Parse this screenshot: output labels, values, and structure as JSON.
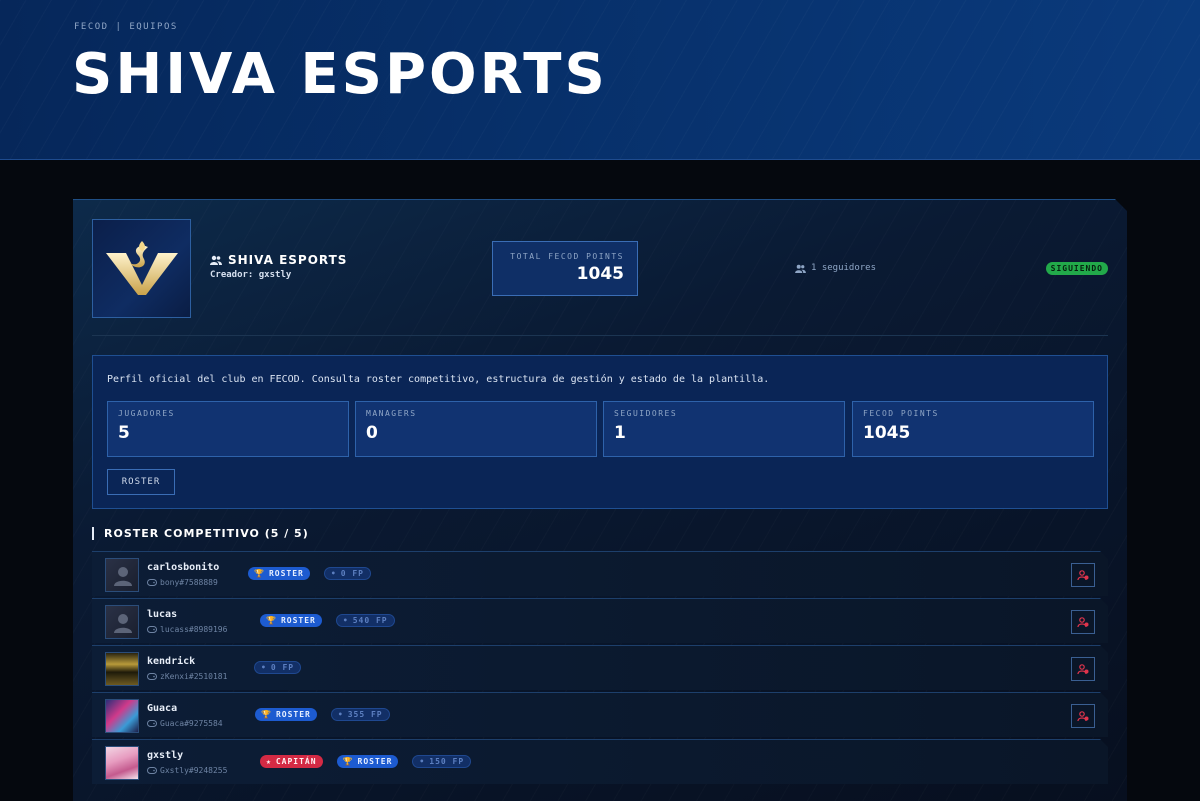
{
  "header": {
    "breadcrumb": "FECOD | EQUIPOS",
    "title": "SHIVA ESPORTS"
  },
  "team": {
    "name": "SHIVA ESPORTS",
    "creator": "Creador: gxstly",
    "points_label": "TOTAL FECOD POINTS",
    "points_value": "1045",
    "followers": "1 seguidores",
    "follow_status": "SIGUIENDO"
  },
  "info": {
    "description": "Perfil oficial del club en FECOD. Consulta roster competitivo, estructura de gestión y estado de la plantilla.",
    "stats": [
      {
        "label": "JUGADORES",
        "value": "5"
      },
      {
        "label": "MANAGERS",
        "value": "0"
      },
      {
        "label": "SEGUIDORES",
        "value": "1"
      },
      {
        "label": "FECOD POINTS",
        "value": "1045"
      }
    ],
    "roster_button": "ROSTER"
  },
  "roster": {
    "title": "ROSTER COMPETITIVO (5 / 5)",
    "players": [
      {
        "name": "carlosbonito",
        "tag": "bony#7588889",
        "roster_badge": "ROSTER",
        "points": "0 FP",
        "captain_badge": ""
      },
      {
        "name": "lucas",
        "tag": "lucass#8989196",
        "roster_badge": "ROSTER",
        "points": "540 FP",
        "captain_badge": ""
      },
      {
        "name": "kendrick",
        "tag": "zKenxi#2510181",
        "roster_badge": "",
        "points": "0 FP",
        "captain_badge": ""
      },
      {
        "name": "Guaca",
        "tag": "Guaca#9275584",
        "roster_badge": "ROSTER",
        "points": "355 FP",
        "captain_badge": ""
      },
      {
        "name": "gxstly",
        "tag": "Gxstly#9248255",
        "roster_badge": "ROSTER",
        "points": "150 FP",
        "captain_badge": "CAPITÁN"
      }
    ]
  },
  "colors": {
    "accent": "#1d5bd0",
    "following": "#22a94a",
    "captain": "#d42a44",
    "remove": "#e0344c"
  },
  "icons": {
    "team": "users-icon",
    "followers": "users-icon",
    "gamepad": "gamepad-icon",
    "trophy": "trophy-icon",
    "star": "star-icon",
    "remove": "remove-user-icon"
  }
}
